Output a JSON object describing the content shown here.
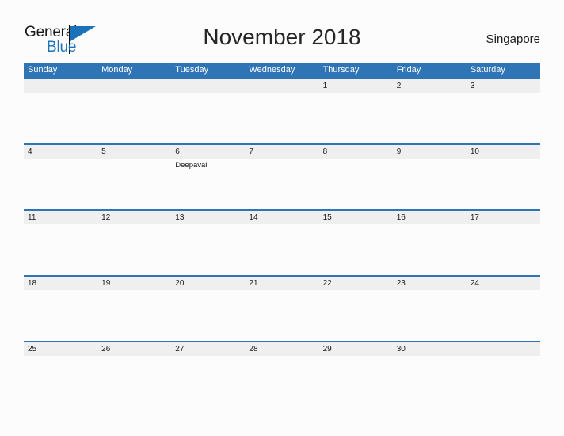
{
  "brand": {
    "name_part1": "General",
    "name_part2": "Blue",
    "flag_color": "#1b72b8"
  },
  "header": {
    "title": "November 2018",
    "region": "Singapore"
  },
  "colors": {
    "header_blue": "#2f74b5",
    "date_band": "#efefef",
    "page_background": "#fcfcfc",
    "text": "#1a1a1a"
  },
  "calendar": {
    "weekdays": [
      "Sunday",
      "Monday",
      "Tuesday",
      "Wednesday",
      "Thursday",
      "Friday",
      "Saturday"
    ],
    "weeks": [
      {
        "dates": [
          "",
          "",
          "",
          "",
          "1",
          "2",
          "3"
        ],
        "events": [
          "",
          "",
          "",
          "",
          "",
          "",
          ""
        ]
      },
      {
        "dates": [
          "4",
          "5",
          "6",
          "7",
          "8",
          "9",
          "10"
        ],
        "events": [
          "",
          "",
          "Deepavali",
          "",
          "",
          "",
          ""
        ]
      },
      {
        "dates": [
          "11",
          "12",
          "13",
          "14",
          "15",
          "16",
          "17"
        ],
        "events": [
          "",
          "",
          "",
          "",
          "",
          "",
          ""
        ]
      },
      {
        "dates": [
          "18",
          "19",
          "20",
          "21",
          "22",
          "23",
          "24"
        ],
        "events": [
          "",
          "",
          "",
          "",
          "",
          "",
          ""
        ]
      },
      {
        "dates": [
          "25",
          "26",
          "27",
          "28",
          "29",
          "30",
          ""
        ],
        "events": [
          "",
          "",
          "",
          "",
          "",
          "",
          ""
        ]
      }
    ]
  }
}
